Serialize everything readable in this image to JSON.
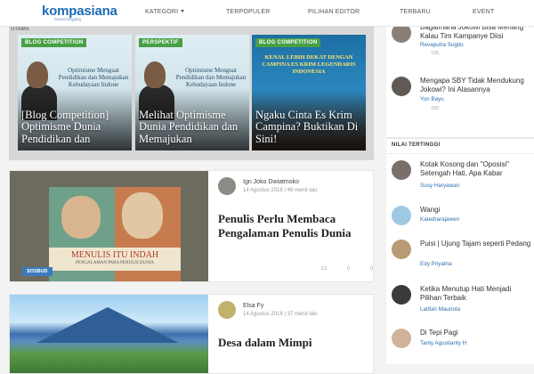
{
  "header": {
    "logo": "kompasiana",
    "tagline": "beyond blogging",
    "nav": [
      "KATEGORI",
      "TERPOPULER",
      "PILIHAN EDITOR",
      "TERBARU",
      "EVENT"
    ]
  },
  "featured": {
    "label": "UTAMA",
    "cards": [
      {
        "category": "BLOG COMPETITION",
        "teaser": "Optimisme Menguat Pendidikan dan Memajukan Kebudayaan Indone",
        "title": "[Blog Competition] Optimisme Dunia Pendidikan dan"
      },
      {
        "category": "PERSPEKTIF",
        "teaser": "Optimisme Menguat Pendidikan dan Memajukan Kebudayaan Indone",
        "title": "Melihat Optimisme Dunia Pendidikan dan Memajukan"
      },
      {
        "category": "BLOG COMPETITION",
        "teaser": "KENAL LEBIH DEKAT DENGAN CAMPINA ES KRIM LEGENDARIS INDONESIA",
        "title": "Ngaku Cinta Es Krim Campina? Buktikan Di Sini!"
      }
    ]
  },
  "posts": [
    {
      "category": "SOSBUD",
      "author": "Ign Joko Dwiatmoko",
      "meta": "14 Agustus 2018 | 49 menit lalu",
      "title": "Penulis Perlu Membaca Pengalaman Penulis Dunia",
      "book_title": "MENULIS ITU INDAH",
      "book_sub": "PENGALAMAN PARA PENULIS DUNIA",
      "stats": [
        "13",
        "0",
        "0"
      ]
    },
    {
      "category": "",
      "author": "Elsa Fy",
      "meta": "14 Agustus 2018 | 37 menit lalu",
      "title": "Desa dalam Mimpi",
      "stats": []
    }
  ],
  "sidebar": {
    "top": [
      {
        "title": "Bagaimana Jokowi Bisa Menang Kalau Tim Kampanye Diisi",
        "author": "Revaputra Sugito",
        "count": "195"
      },
      {
        "title": "Mengapa SBY Tidak Mendukung Jokowi? Ini Alasannya",
        "author": "Yon Bayu",
        "count": "180"
      }
    ],
    "section_title": "NILAI TERTINGGI",
    "highest": [
      {
        "title": "Kotak Kosong dan \"Oposisi\" Setengah Hati, Apa Kabar",
        "author": "Susy Haryawan"
      },
      {
        "title": "Wangi",
        "author": "Katedrarajawen"
      },
      {
        "title": "Puisi | Ujung Tajam seperti Pedang",
        "author": "Edy Priyatna"
      },
      {
        "title": "Ketika Menutup Hati Menjadi Pilihan Terbaik",
        "author": "Latifah Maurinta"
      },
      {
        "title": "Di Tepi Pagi",
        "author": "Tanty Agustianty H"
      }
    ]
  },
  "colors": {
    "brand": "#1c6bb5",
    "green_badge": "#48a046",
    "blue_badge": "#3c7bbf"
  }
}
